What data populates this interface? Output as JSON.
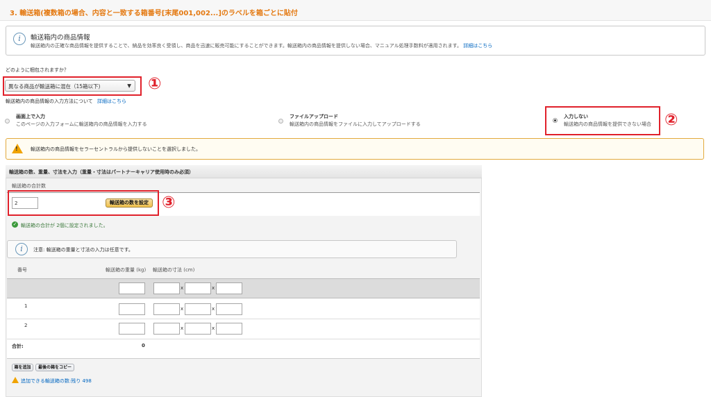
{
  "header": {
    "title": "3. 輸送箱(複数箱の場合、内容と一致する箱番号[末尾001,002...]のラベルを箱ごとに貼付"
  },
  "info": {
    "title": "輸送箱内の商品情報",
    "desc": "輸送箱内の正確な商品情報を提供することで、納品を効率良く受領し、商品を迅速に販売可能にすることができます。輸送箱内の商品情報を提供しない場合、マニュアル処理手数料が適用されます。",
    "link": "詳細はこちら"
  },
  "packing": {
    "question": "どのように梱包されますか？",
    "selected": "異なる商品が輸送箱に混在（15箱以下)",
    "arrow": "▼",
    "method_label": "輸送箱内の商品情報の入力方法について",
    "method_link": "詳細はこちら"
  },
  "options": [
    {
      "title": "画面上で入力",
      "desc": "このページの入力フォームに輸送箱内の商品情報を入力する"
    },
    {
      "title": "ファイルアップロード",
      "desc": "輸送箱内の商品情報をファイルに入力してアップロードする"
    },
    {
      "title": "入力しない",
      "desc": "輸送箱内の商品情報を提供できない場合"
    }
  ],
  "callouts": {
    "one": "①",
    "two": "②",
    "three": "③"
  },
  "warning": {
    "text": "輸送箱内の商品情報をセラーセントラルから提供しないことを選択しました。"
  },
  "boxes": {
    "title": "輸送箱の数、重量、寸法を入力（重量・寸法はパートナーキャリア使用時のみ必須）",
    "count_label": "輸送箱の合計数",
    "count_value": "2",
    "set_button": "輸送箱の数を設定",
    "success": "輸送箱の合計が 2個に設定されました。",
    "note": "注意: 輸送箱の重量と寸法の入力は任意です。",
    "col_number": "番号",
    "col_weight": "輸送箱の重量 (kg)",
    "col_dims": "輸送箱の寸法 (cm)",
    "rows": [
      "1",
      "2"
    ],
    "times": "x",
    "total_label": "合計:",
    "total_value": "0",
    "add_button": "箱を追加",
    "copy_button": "最後の箱をコピー",
    "remaining": "追加できる輸送箱の数:残り 498"
  },
  "colors": {
    "accent": "#e47911",
    "callout": "#e0202a",
    "link": "#0066c0",
    "success": "#3c9a3c"
  }
}
